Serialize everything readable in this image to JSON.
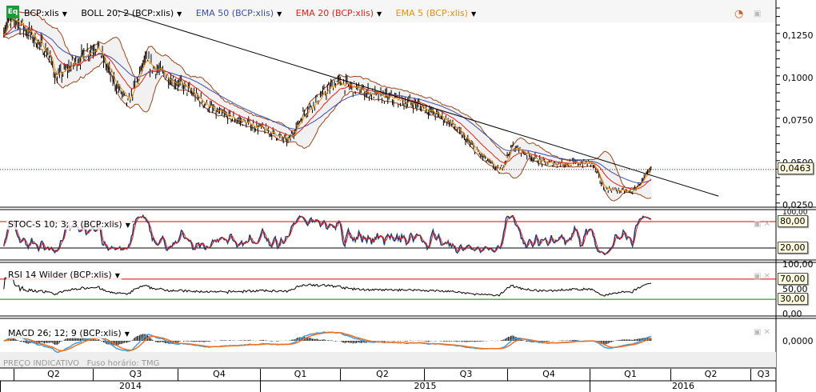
{
  "legend": {
    "symbol": "BCP:xlis",
    "boll": "BOLL 20; 2 (BCP:xlis)",
    "ema50": "EMA 50 (BCP:xlis)",
    "ema20": "EMA 20 (BCP:xlis)",
    "ema5": "EMA 5 (BCP:xlis)",
    "logo": "Eq"
  },
  "colors": {
    "ema50": "#3b4fa8",
    "ema20": "#e8201a",
    "ema5": "#e8900a",
    "boll": "#a0441a",
    "stoch_k": "#1f3b7a",
    "stoch_d": "#e8201a",
    "macd": "#3f9de0",
    "signal": "#f07020"
  },
  "panes": {
    "stoch": {
      "label": "STOC-S 10; 3; 3 (BCP:xlis)",
      "upper": "80,00",
      "lower": "20,00",
      "top": "100,00"
    },
    "rsi": {
      "label": "RSI 14 Wilder (BCP:xlis)",
      "upper": "70,00",
      "lower": "30,00",
      "ticks": [
        "100,00",
        "50,00",
        "0,00"
      ]
    },
    "macd": {
      "label": "MACD 26; 12; 9 (BCP:xlis)",
      "zero": "0,0000"
    }
  },
  "price_axis": [
    "0,1250",
    "0,1000",
    "0,0750",
    "0,0500",
    "0,0250"
  ],
  "last_price": "0,0463",
  "footer": {
    "indicative": "PREÇO INDICATIVO",
    "timezone": "Fuso horário: TMG"
  },
  "time_axis": {
    "quarters": [
      "Q2",
      "Q3",
      "Q4",
      "Q1",
      "Q2",
      "Q3",
      "Q4",
      "Q1",
      "Q2",
      "Q3"
    ],
    "years": [
      "2014",
      "2015",
      "2016"
    ]
  },
  "chart_data": {
    "type": "ohlc",
    "series": [
      {
        "name": "BCP:xlis",
        "dates": [
          "2014-03-21",
          "2014-04-04",
          "2014-05-10",
          "2014-05-19",
          "2014-07-03",
          "2014-07-21",
          "2014-08-08",
          "2014-08-26",
          "2014-10-10",
          "2014-11-15",
          "2015-01-08",
          "2015-02-04",
          "2015-02-22",
          "2015-03-30",
          "2015-05-14",
          "2015-06-28",
          "2015-08-03",
          "2015-09-08",
          "2015-09-30",
          "2015-10-14",
          "2015-11-19",
          "2016-01-12",
          "2016-01-25",
          "2016-02-26",
          "2016-03-19"
        ],
        "close": [
          0.13,
          0.135,
          0.115,
          0.1,
          0.12,
          0.1,
          0.085,
          0.11,
          0.095,
          0.08,
          0.07,
          0.063,
          0.08,
          0.098,
          0.09,
          0.085,
          0.075,
          0.055,
          0.045,
          0.06,
          0.05,
          0.05,
          0.035,
          0.033,
          0.0463
        ]
      }
    ],
    "trendline": {
      "from": [
        "2014-07-27",
        0.14
      ],
      "to": [
        "2016-06-02",
        0.0306
      ]
    },
    "ylim": [
      0.02,
      0.145
    ]
  }
}
